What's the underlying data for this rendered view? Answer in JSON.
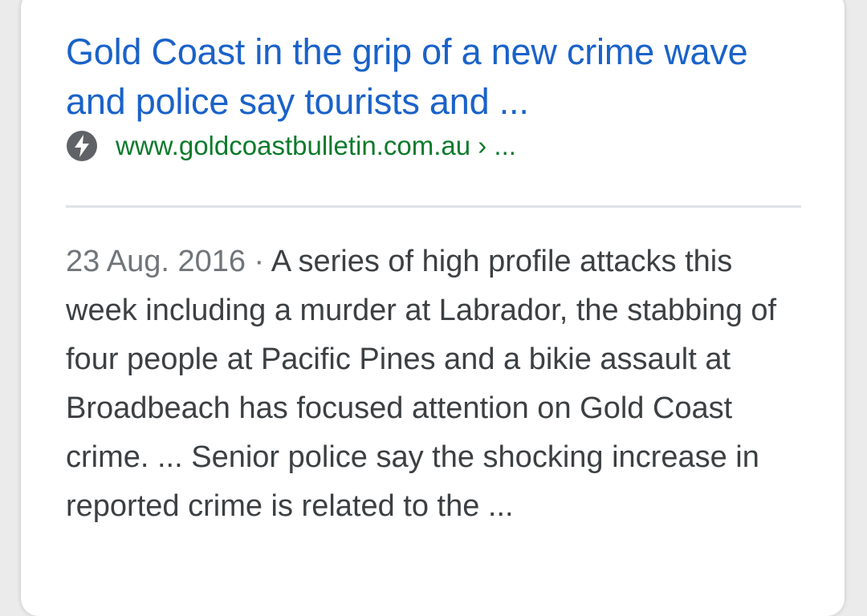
{
  "result": {
    "title": "Gold Coast in the grip of a new crime wave and police say tourists and ...",
    "url": "www.goldcoastbulletin.com.au › ...",
    "amp_icon": "amp-lightning-icon",
    "date": "23 Aug. 2016",
    "separator": " · ",
    "snippet": "A series of high profile attacks this week including a murder at Labrador, the stabbing of four people at Pacific Pines and a bikie assault at Broadbeach has focused attention on Gold Coast crime. ... Senior police say the shocking increase in reported crime is related to the ..."
  },
  "colors": {
    "title_link": "#1a62c9",
    "url": "#0d7a2a",
    "date": "#70757a",
    "snippet_text": "#3c4043",
    "icon": "#5f6368"
  }
}
